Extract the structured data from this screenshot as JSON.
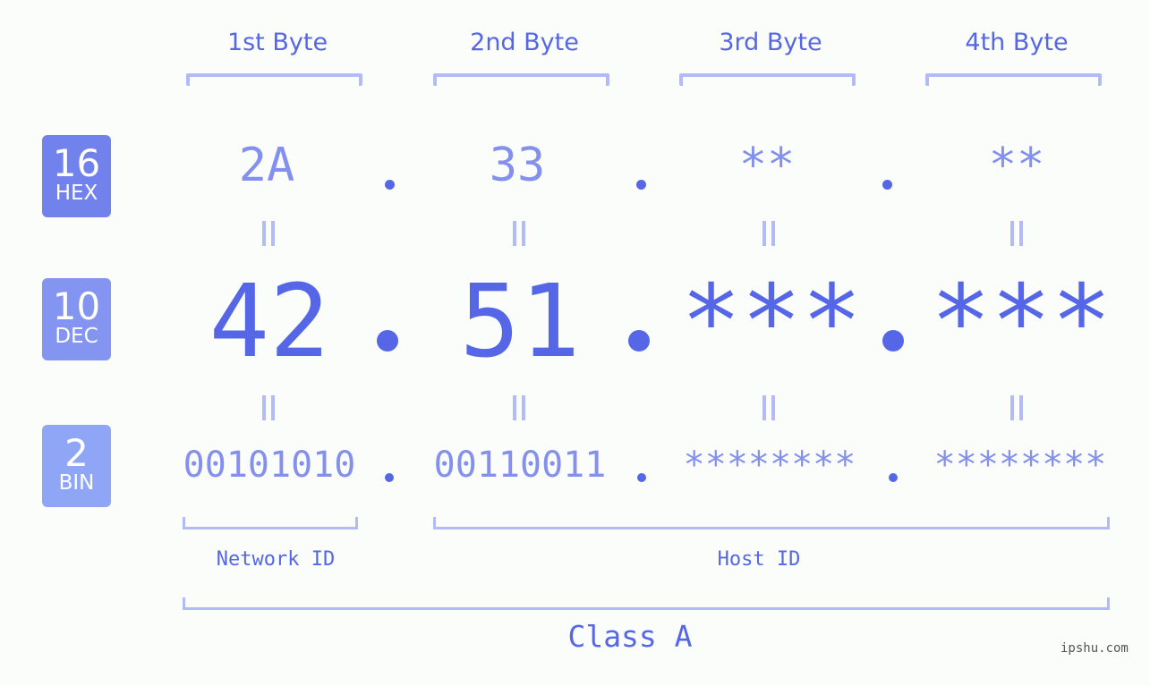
{
  "headers": [
    "1st Byte",
    "2nd Byte",
    "3rd Byte",
    "4th Byte"
  ],
  "badges": [
    {
      "number": "16",
      "label": "HEX",
      "color": "#7282ec"
    },
    {
      "number": "10",
      "label": "DEC",
      "color": "#8494f1"
    },
    {
      "number": "2",
      "label": "BIN",
      "color": "#8fa6f7"
    }
  ],
  "hex": [
    "2A",
    "33",
    "**",
    "**"
  ],
  "dec": [
    "42",
    "51",
    "***",
    "***"
  ],
  "bin": [
    "00101010",
    "00110011",
    "********",
    "********"
  ],
  "separator": ".",
  "network_label": "Network ID",
  "host_label": "Host ID",
  "class_label": "Class A",
  "brand": "ipshu.com",
  "colors": {
    "accent": "#5567e6",
    "light": "#8490ee",
    "bracket": "#b3bbf6",
    "background": "#fbfdfb"
  }
}
